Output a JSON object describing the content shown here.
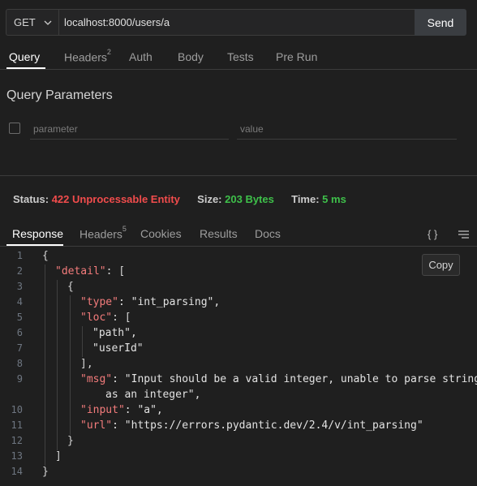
{
  "request": {
    "method": "GET",
    "url": "localhost:8000/users/a",
    "send_label": "Send"
  },
  "request_tabs": [
    {
      "label": "Query",
      "active": true
    },
    {
      "label": "Headers",
      "count": "2"
    },
    {
      "label": "Auth"
    },
    {
      "label": "Body"
    },
    {
      "label": "Tests"
    },
    {
      "label": "Pre Run"
    }
  ],
  "query": {
    "title": "Query Parameters",
    "param_placeholder": "parameter",
    "value_placeholder": "value"
  },
  "status": {
    "status_label": "Status:",
    "status_value": "422 Unprocessable Entity",
    "size_label": "Size:",
    "size_value": "203 Bytes",
    "time_label": "Time:",
    "time_value": "5 ms"
  },
  "response_tabs": [
    {
      "label": "Response",
      "active": true
    },
    {
      "label": "Headers",
      "count": "5"
    },
    {
      "label": "Cookies"
    },
    {
      "label": "Results"
    },
    {
      "label": "Docs"
    }
  ],
  "response_tools": {
    "format_icon": "{ }",
    "menu_icon": "menu-lines-icon",
    "copy_label": "Copy"
  },
  "response_body": {
    "line_numbers": [
      "1",
      "2",
      "3",
      "4",
      "5",
      "6",
      "7",
      "8",
      "9",
      "10",
      "11",
      "12",
      "13",
      "14"
    ],
    "open_brace": "{",
    "detail_key": "\"detail\"",
    "detail_open": ": [",
    "item_open": "{",
    "type_key": "\"type\"",
    "type_value": ": \"int_parsing\",",
    "loc_key": "\"loc\"",
    "loc_open": ": [",
    "loc_path": "\"path\",",
    "loc_userid": "\"userId\"",
    "loc_close": "],",
    "msg_key": "\"msg\"",
    "msg_value_1": ": \"Input should be a valid integer, unable to parse string",
    "msg_value_2": "as an integer\",",
    "input_key": "\"input\"",
    "input_value": ": \"a\",",
    "url_key": "\"url\"",
    "url_value": ": \"https://errors.pydantic.dev/2.4/v/int_parsing\"",
    "item_close": "}",
    "detail_close": "]",
    "close_brace": "}"
  },
  "colors": {
    "background": "#1f1f1f",
    "error": "#f14c4c",
    "success": "#3ec04a",
    "json_key": "#f47c7c"
  }
}
